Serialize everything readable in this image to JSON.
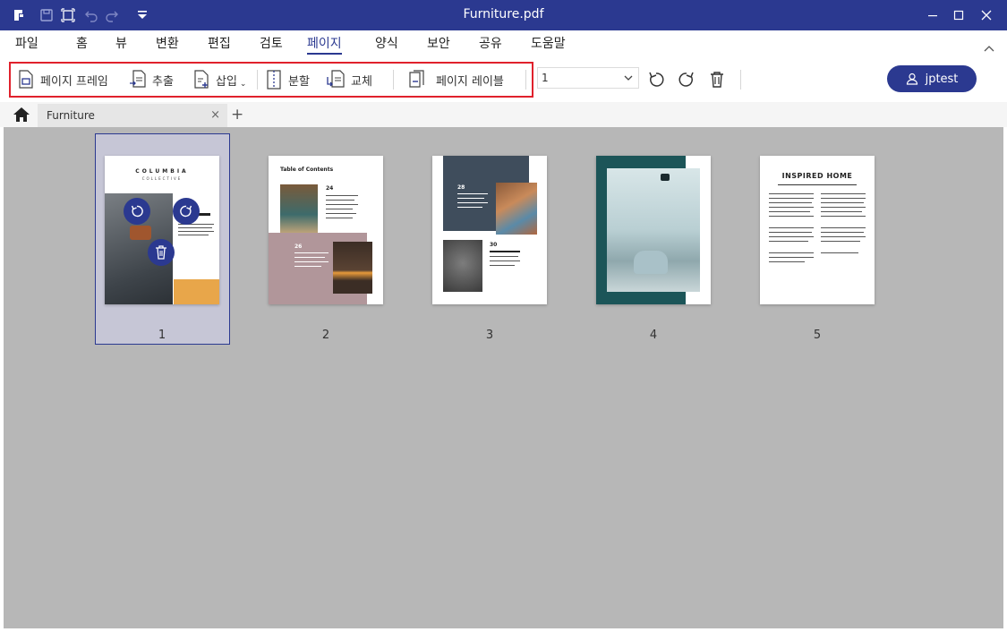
{
  "window": {
    "title": "Furniture.pdf",
    "minimize_icon": "minimize-icon",
    "maximize_icon": "maximize-icon",
    "close_icon": "close-icon"
  },
  "quick_access": [
    "app-logo-icon",
    "save-icon",
    "fit-icon",
    "undo-icon",
    "redo-icon",
    "customize-dropdown-icon"
  ],
  "menu": {
    "items": [
      {
        "label": "파일"
      },
      {
        "label": "홈"
      },
      {
        "label": "뷰"
      },
      {
        "label": "변환"
      },
      {
        "label": "편집"
      },
      {
        "label": "검토"
      },
      {
        "label": "페이지",
        "active": true
      },
      {
        "label": "양식"
      },
      {
        "label": "보안"
      },
      {
        "label": "공유"
      },
      {
        "label": "도움말"
      }
    ],
    "collapse_icon": "collapse-ribbon-icon"
  },
  "toolbar": {
    "page_frame_label": "페이지 프레임",
    "extract_label": "추출",
    "insert_label": "삽입",
    "split_label": "분할",
    "replace_label": "교체",
    "page_label_label": "페이지 레이블",
    "page_select_value": "1",
    "rotate_left_icon": "rotate-left-icon",
    "rotate_right_icon": "rotate-right-icon",
    "delete_icon": "trash-icon",
    "user_name": "jptest"
  },
  "tabs": {
    "home_icon": "home-icon",
    "doc_tab_label": "Furniture",
    "close_tab": "×",
    "add_tab": "+"
  },
  "pages": {
    "numbers": [
      "1",
      "2",
      "3",
      "4",
      "5"
    ],
    "p1_title": "COLUMBIA",
    "p1_subtitle": "COLLECTIVE",
    "p2_title": "Table of Contents",
    "p2_num_a": "24",
    "p2_num_b": "26",
    "p3_num_a": "28",
    "p3_num_b": "30",
    "p5_title": "INSPIRED HOME"
  },
  "colors": {
    "brand": "#2b3990",
    "highlight": "#e0212c",
    "content_bg": "#b7b7b7"
  }
}
